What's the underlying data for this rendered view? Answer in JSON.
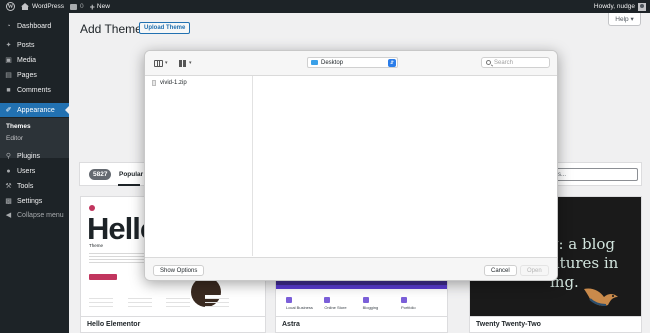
{
  "admin_bar": {
    "site_name": "WordPress",
    "comments_count": "0",
    "new_label": "New",
    "howdy": "Howdy, nudge"
  },
  "sidebar": {
    "items": [
      {
        "label": "Dashboard",
        "icon": "dashboard-icon"
      },
      {
        "label": "Posts",
        "icon": "pin-icon"
      },
      {
        "label": "Media",
        "icon": "media-icon"
      },
      {
        "label": "Pages",
        "icon": "pages-icon"
      },
      {
        "label": "Comments",
        "icon": "comments-icon"
      },
      {
        "label": "Appearance",
        "icon": "brush-icon"
      },
      {
        "label": "Plugins",
        "icon": "plug-icon"
      },
      {
        "label": "Users",
        "icon": "users-icon"
      },
      {
        "label": "Tools",
        "icon": "wrench-icon"
      },
      {
        "label": "Settings",
        "icon": "settings-icon"
      },
      {
        "label": "Collapse menu",
        "icon": "collapse-icon"
      }
    ],
    "submenu": [
      "Themes",
      "Editor"
    ]
  },
  "header": {
    "title": "Add Themes",
    "upload_label": "Upload Theme",
    "help_label": "Help ▾"
  },
  "filter": {
    "count": "5827",
    "active_tab": "Popular",
    "search_placeholder": "ss..."
  },
  "themes": [
    {
      "name": "Hello Elementor",
      "preview_title": "Hello",
      "preview_sub": "Theme"
    },
    {
      "name": "Astra",
      "preview_cols": [
        "Local Business",
        "Online Store",
        "Blogging",
        "Portfolio"
      ]
    },
    {
      "name": "Twenty Twenty-Two",
      "preview_text_1": "y: a blog",
      "preview_text_2": "ntures in",
      "preview_text_3": "ing."
    }
  ],
  "dialog": {
    "location": "Desktop",
    "search_placeholder": "Search",
    "files": [
      "vivid-1.zip"
    ],
    "show_options_label": "Show Options",
    "cancel_label": "Cancel",
    "open_label": "Open"
  },
  "colors": {
    "admin_dark": "#1d2327",
    "accent_blue": "#2271b1",
    "folder_blue": "#3aa0e8"
  }
}
